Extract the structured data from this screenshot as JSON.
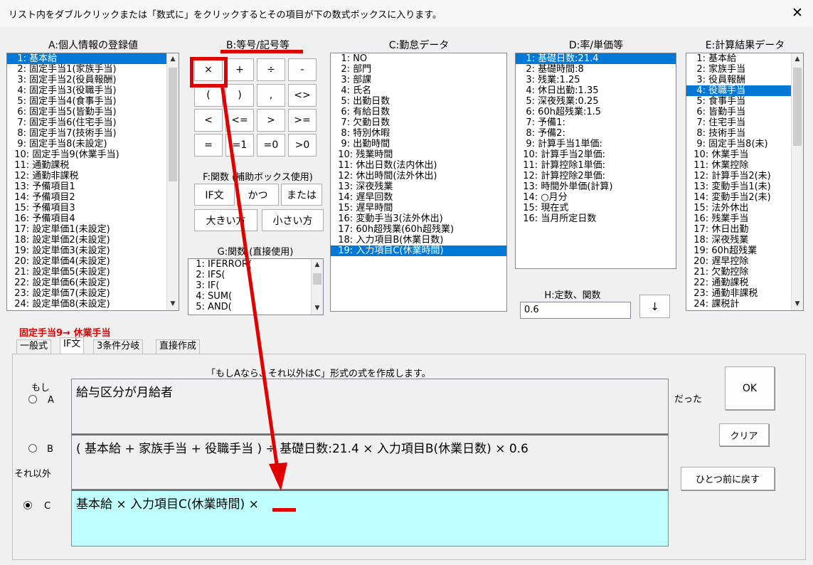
{
  "window": {
    "title": "リスト内をダブルクリックまたは「数式に」をクリックするとその項目が下の数式ボックスに入ります。",
    "close": "✕"
  },
  "panelA": {
    "title": "A:個人情報の登録値",
    "items": [
      "1: 基本給",
      "2: 固定手当1(家族手当)",
      "3: 固定手当2(役員報酬)",
      "4: 固定手当3(役職手当)",
      "5: 固定手当4(食事手当)",
      "6: 固定手当5(皆勤手当)",
      "7: 固定手当6(住宅手当)",
      "8: 固定手当7(技術手当)",
      "9: 固定手当8(未設定)",
      "10: 固定手当9(休業手当)",
      "11: 通勤課税",
      "12: 通勤非課税",
      "13: 予備項目1",
      "14: 予備項目2",
      "15: 予備項目3",
      "16: 予備項目4",
      "17: 設定単価1(未設定)",
      "18: 設定単価2(未設定)",
      "19: 設定単価3(未設定)",
      "20: 設定単価4(未設定)",
      "21: 設定単価5(未設定)",
      "22: 設定単価6(未設定)",
      "23: 設定単価7(未設定)",
      "24: 設定単価8(未設定)"
    ]
  },
  "panelB": {
    "title": "B:等号/記号等",
    "buttons": [
      "×",
      "+",
      "÷",
      "-",
      "(",
      ")",
      ",",
      "<>",
      "<",
      "<=",
      ">",
      ">=",
      "=",
      "=1",
      "=0",
      ">0"
    ]
  },
  "panelF": {
    "title": "F:関数 (補助ボックス使用)",
    "buttons": [
      "IF文",
      "かつ",
      "または",
      "大きい方",
      "小さい方"
    ]
  },
  "panelG": {
    "title": "G:関数 (直接使用)",
    "items": [
      "1: IFERROR(",
      "2: IFS(",
      "3: IF(",
      "4: SUM(",
      "5: AND("
    ]
  },
  "panelC": {
    "title": "C:勤怠データ",
    "items": [
      "1: NO",
      "2: 部門",
      "3: 部課",
      "4: 氏名",
      "5: 出勤日数",
      "6: 有給日数",
      "7: 欠勤日数",
      "8: 特別休暇",
      "9: 出勤時間",
      "10: 残業時間",
      "11: 休出日数(法内休出)",
      "12: 休出時間(法外休出)",
      "13: 深夜残業",
      "14: 遅早回数",
      "15: 遅早時間",
      "16: 変動手当3(法外休出)",
      "17: 60h超残業(60h超残業)",
      "18: 入力項目B(休業日数)",
      "19: 入力項目C(休業時間)"
    ]
  },
  "panelD": {
    "title": "D:率/単価等",
    "items": [
      "1: 基礎日数:21.4",
      "2: 基礎時間:8",
      "3: 残業:1.25",
      "4: 休日出勤:1.35",
      "5: 深夜残業:0.25",
      "6: 60h超残業:1.5",
      "7: 予備1:",
      "8: 予備2:",
      "9: 計算手当1単価:",
      "10: 計算手当2単価:",
      "11: 計算控除1単価:",
      "12: 計算控除2単価:",
      "13: 時間外単価(計算)",
      "14: ○月分",
      "15: 現在式",
      "16: 当月所定日数"
    ]
  },
  "panelH": {
    "title": "H:定数、関数",
    "value": "0.6",
    "down": "↓"
  },
  "panelE": {
    "title": "E:計算結果データ",
    "items": [
      "1: 基本給",
      "2: 家族手当",
      "3: 役員報酬",
      "4: 役職手当",
      "5: 食事手当",
      "6: 皆勤手当",
      "7: 住宅手当",
      "8: 技術手当",
      "9: 固定手当8(未)",
      "10: 休業手当",
      "11: 休業控除",
      "12: 計算手当2(未)",
      "13: 変動手当1(未)",
      "14: 変動手当2(未)",
      "15: 法外休出",
      "16: 残業手当",
      "17: 休日出勤",
      "18: 深夜残業",
      "19: 60h超残業",
      "20: 遅早控除",
      "21: 欠勤控除",
      "22: 通勤課税",
      "23: 通勤非課税",
      "24: 課税計"
    ]
  },
  "target": {
    "label": "固定手当9→ 休業手当"
  },
  "tabs": [
    "一般式",
    "IF文",
    "3条件分岐",
    "直接作成"
  ],
  "ifform": {
    "caption": "「もしAなら、それ以外はC」形式の式を作成します。",
    "if_label": "もし",
    "else_label": "それ以外",
    "a_label": "A",
    "b_label": "B",
    "c_label": "C",
    "a_text": "給与区分が月給者",
    "b_text": "( 基本給 + 家族手当 + 役職手当 ) ÷ 基礎日数:21.4 × 入力項目B(休業日数) × 0.6",
    "c_text": "基本給 × 入力項目C(休業時間) ×",
    "datta": "だった",
    "ok": "OK",
    "clear": "クリア",
    "undo": "ひとつ前に戻す"
  },
  "colors": {
    "selection": "#0078d7",
    "annotation": "#e00000",
    "c_box": "#bfffff",
    "target_label": "#e00000"
  }
}
